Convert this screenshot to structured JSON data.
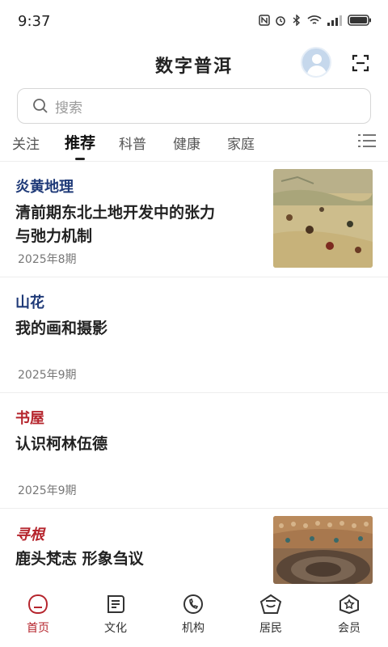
{
  "status_bar": {
    "time": "9:37"
  },
  "header": {
    "title": "数字普洱"
  },
  "search": {
    "placeholder": "搜索"
  },
  "tabs": [
    {
      "label": "关注"
    },
    {
      "label": "推荐",
      "active": true
    },
    {
      "label": "科普"
    },
    {
      "label": "健康"
    },
    {
      "label": "家庭"
    }
  ],
  "articles": [
    {
      "column": "炎黄地理",
      "column_color": "#1f3a78",
      "title_line1": "清前期东北土地开发中的张力",
      "title_line2": "与弛力机制",
      "date": "2025年8期",
      "has_thumb": true
    },
    {
      "column": "山花",
      "column_color": "#1f3a78",
      "title_line1": "我的画和摄影",
      "date": "2025年9期",
      "has_thumb": false
    },
    {
      "column": "书屋",
      "column_color": "#b5242c",
      "title_line1": "认识柯林伍德",
      "date": "2025年9期",
      "has_thumb": false
    },
    {
      "column": "寻根",
      "column_color": "#b5242c",
      "title_line1": "鹿头梵志 形象刍议",
      "has_thumb": true
    }
  ],
  "bottom_nav": [
    {
      "label": "首页",
      "icon": "home-icon",
      "active": true
    },
    {
      "label": "文化",
      "icon": "culture-icon"
    },
    {
      "label": "机构",
      "icon": "institution-icon"
    },
    {
      "label": "居民",
      "icon": "residents-icon"
    },
    {
      "label": "会员",
      "icon": "member-icon"
    }
  ],
  "colors": {
    "accent": "#b5242c",
    "navy": "#1f3a78"
  }
}
